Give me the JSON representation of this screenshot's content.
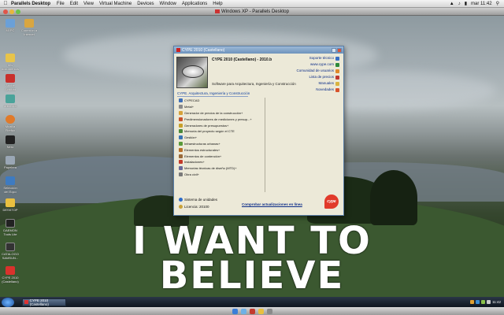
{
  "macbar": {
    "app_name": "Parallels Desktop",
    "menus": [
      "File",
      "Edit",
      "View",
      "Virtual Machine",
      "Devices",
      "Window",
      "Applications",
      "Help"
    ],
    "clock": "mar 11:42"
  },
  "vm_window": {
    "title": "Windows XP - Parallels Desktop"
  },
  "desktop": {
    "icons": [
      {
        "label": "Mi PC",
        "color": "#6aa0d8"
      },
      {
        "label": "Conexión a Internet",
        "color": "#d9a640"
      },
      {
        "label": "Mis documentos",
        "color": "#e8c44a"
      },
      {
        "label": "Adobe Acrobat",
        "color": "#c9302c"
      },
      {
        "label": "AutoCAD",
        "color": "#4aa39a"
      },
      {
        "label": "Mozilla Firefox",
        "color": "#e07a2a"
      },
      {
        "label": "Nero",
        "color": "#222222"
      },
      {
        "label": "Papelera",
        "color": "#9aa7b5"
      },
      {
        "label": "Selección del Eqco",
        "color": "#3e7bc1"
      },
      {
        "label": "DESKTOP",
        "color": "#e9c040"
      },
      {
        "label": "DAEMON Tools Lite",
        "color": "#222222"
      },
      {
        "label": "CATALOGO SAMSUN...",
        "color": "#333333"
      },
      {
        "label": "CYPE 2010 (Castellano)",
        "color": "#d9322c"
      }
    ],
    "wallpaper_line1": "I WANT TO",
    "wallpaper_line2": "BELIEVE"
  },
  "app": {
    "title": "CYPE 2010 (Castellano)",
    "product_title": "CYPE 2010 (Castellano) - 2010.b",
    "product_subtitle": "Software para Arquitectura, Ingeniería y Construcción",
    "links": [
      {
        "label": "Soporte técnico",
        "color": "#3a6fc4"
      },
      {
        "label": "www.cype.com",
        "color": "#2f8a3a"
      },
      {
        "label": "Comunidad de usuarios",
        "color": "#e08a2a"
      },
      {
        "label": "Lista de precios",
        "color": "#c03a30"
      },
      {
        "label": "Manuales",
        "color": "#d9b440"
      },
      {
        "label": "Novedades",
        "color": "#d8542c"
      }
    ],
    "group_label": "CYPE. Arquitectura, Ingeniería y Construcción",
    "modules": [
      {
        "label": "CYPECAD",
        "color": "#3e6fb8"
      },
      {
        "label": "Metal+",
        "color": "#8a8a8a"
      },
      {
        "label": "Generador de precios de la construcción+",
        "color": "#d6a23a"
      },
      {
        "label": "Predimensionadores de mediciones y presup...+",
        "color": "#c8512a"
      },
      {
        "label": "Generadores de presupuestos+",
        "color": "#c8a02a"
      },
      {
        "label": "Memoria del proyecto según el CTE",
        "color": "#4a8a3a"
      },
      {
        "label": "Gestión+",
        "color": "#3a74b4"
      },
      {
        "label": "Infraestructuras urbanas+",
        "color": "#5a9a3a"
      },
      {
        "label": "Elementos estructurales+",
        "color": "#b8702a"
      },
      {
        "label": "Elementos de contención+",
        "color": "#9a6a3a"
      },
      {
        "label": "Instalaciones+",
        "color": "#c33a2a"
      },
      {
        "label": "Memorias técnicas de diseño (MTD)+",
        "color": "#6a6a9a"
      },
      {
        "label": "Obra civil+",
        "color": "#7a7a7a"
      }
    ],
    "system_units": "Sistema de unidades",
    "license": "Licencia: 20100",
    "update_link": "Comprobar actualizaciones en línea",
    "logo_text": "cype"
  },
  "taskbar": {
    "task_label": "CYPE 2010 (Castellano)",
    "clock": "11:42"
  }
}
